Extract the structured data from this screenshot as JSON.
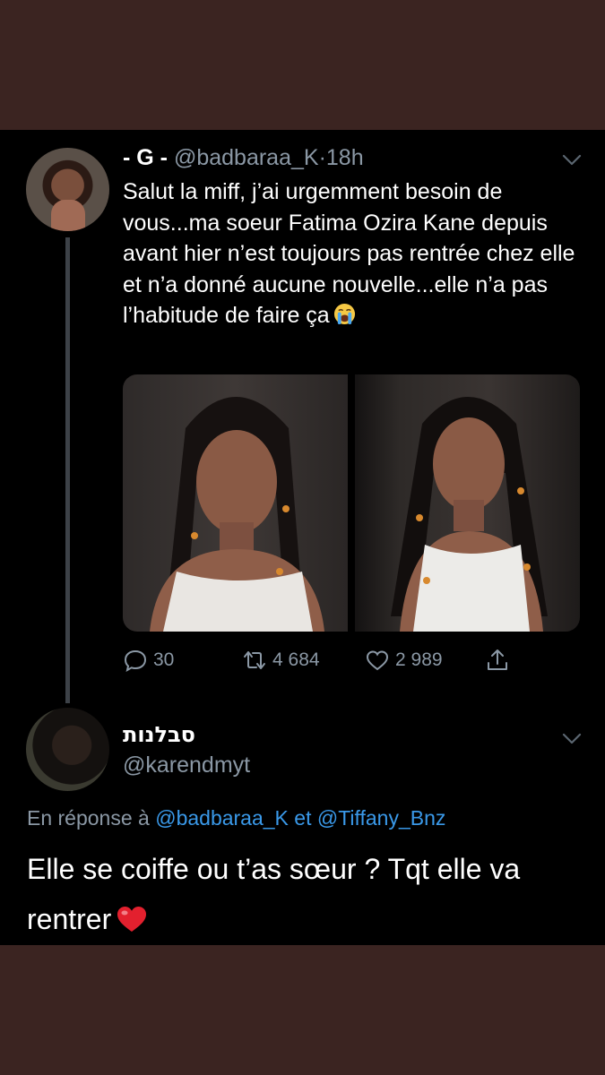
{
  "tweet": {
    "display_name": "- G -",
    "handle": "@badbaraa_K",
    "separator": "·",
    "time": "18h",
    "text": "Salut la miff, j’ai urgemment besoin de vous...ma soeur Fatima Ozira Kane depuis avant hier n’est toujours pas rentrée chez elle et n’a donné aucune nouvelle...elle n’a pas l’habitude de faire ça",
    "text_emoji": "loudly-crying-face-emoji",
    "media_count": 2,
    "actions": {
      "replies": "30",
      "retweets": "4 684",
      "likes": "2 989"
    }
  },
  "reply": {
    "display_name": "סבלנות",
    "handle": "@karendmyt",
    "in_reply_prefix": "En réponse à",
    "in_reply_user1": "@badbaraa_K",
    "in_reply_joiner": "et",
    "in_reply_user2": "@Tiffany_Bnz",
    "text": "Elle se coiffe ou t’as sœur ? Tqt elle va rentrer",
    "text_emoji": "red-heart-emoji"
  },
  "colors": {
    "background_frame": "#3b2421",
    "screen": "#000000",
    "muted": "#8b98a5",
    "link": "#3a99e9"
  }
}
